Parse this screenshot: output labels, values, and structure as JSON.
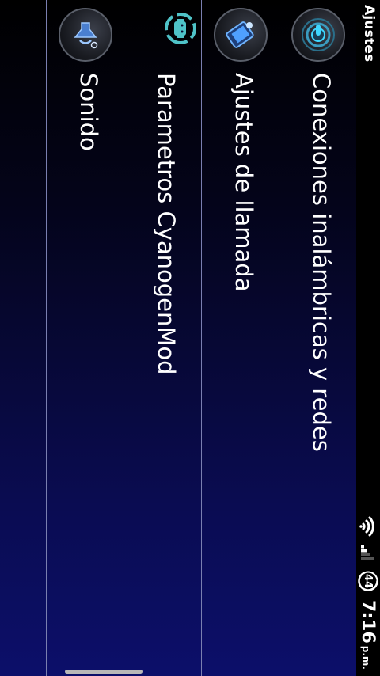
{
  "statusbar": {
    "title": "Ajustes",
    "time": "7:16",
    "ampm": "p.m.",
    "battery": "44",
    "icons": [
      "wifi-icon",
      "signal-icon",
      "battery-icon"
    ]
  },
  "settings": {
    "items": [
      {
        "label": "Conexiones inalámbricas y redes",
        "icon": "wireless-network-icon"
      },
      {
        "label": "Ajustes de llamada",
        "icon": "phone-call-icon"
      },
      {
        "label": "Parametros CyanogenMod",
        "icon": "cyanogenmod-android-icon"
      },
      {
        "label": "Sonido",
        "icon": "sound-icon"
      }
    ]
  },
  "colors": {
    "background_dark": "#000000",
    "background_blue": "#0c0f6a",
    "divider": "#7a7fb0",
    "text": "#ffffff",
    "accent_cyan": "#3fd7ff"
  }
}
